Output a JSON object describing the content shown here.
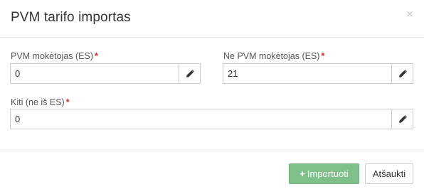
{
  "dialog": {
    "title": "PVM tarifo importas",
    "close_glyph": "×"
  },
  "fields": {
    "vat_payer_es": {
      "label": "PVM mokėtojas (ES)",
      "required_mark": "*",
      "value": "0",
      "edit_icon": "pencil-icon"
    },
    "non_vat_payer_es": {
      "label": "Ne PVM mokėtojas (ES)",
      "required_mark": "*",
      "value": "21",
      "edit_icon": "pencil-icon"
    },
    "other_non_es": {
      "label": "Kiti (ne iš ES)",
      "required_mark": "*",
      "value": "0",
      "edit_icon": "pencil-icon"
    }
  },
  "footer": {
    "import_icon": "+",
    "import_label": "Importuoti",
    "cancel_label": "Atšaukti"
  },
  "colors": {
    "required": "#c9302c",
    "import_button": "#7fbf8a",
    "border": "#cccccc"
  }
}
